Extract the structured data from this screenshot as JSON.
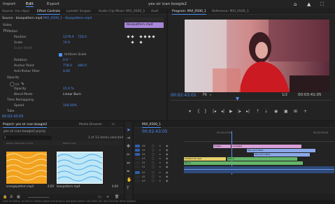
{
  "app": {
    "menus": [
      "Import",
      "Edit",
      "Export"
    ],
    "active_menu": "Edit",
    "title": "yes sir ican boogie2"
  },
  "source_panel": {
    "tabs": [
      "Source: (no clips)",
      "Effect Controls",
      "Lumetri Scopes",
      "Audio Clip Mixer: MVI_0500_1",
      "Audi"
    ],
    "active_tab": "Effect Controls",
    "clip_header": "Source · bluepattern.mp4",
    "seq_header": "MVI_0500_1 · bluepattern.mp4",
    "clip_tag": "bluepattern.mp4",
    "video_label": "Video",
    "motion_label": "Motion",
    "position_label": "Position",
    "position_x": "1279.9",
    "position_y": "720.0",
    "scale_label": "Scale",
    "scale_val": "74.9",
    "scale_width_label": "Scale Width",
    "uniform_scale_label": "Uniform Scale",
    "rotation_label": "Rotation",
    "rotation_val": "0.0 °",
    "anchor_label": "Anchor Point",
    "anchor_x": "778.0",
    "anchor_y": "480.0",
    "antiflicker_label": "Anti-flicker Filter",
    "antiflicker_val": "0.00",
    "opacity_section": "Opacity",
    "opacity_label": "Opacity",
    "opacity_val": "15.0 %",
    "blend_label": "Blend Mode",
    "blend_val": "Linear Burn",
    "time_remap_label": "Time Remapping",
    "speed_label": "Speed",
    "speed_val": "100.00%",
    "tube_label": "Tube",
    "timecode": "00:02:43:05"
  },
  "program_panel": {
    "tabs": [
      "Program: MVI_0500_1",
      "Reference: MVI_0500_1"
    ],
    "active_tab": "Program: MVI_0500_1",
    "timecode": "00:02:43:05",
    "fit": "Fit",
    "resolution": "1/2",
    "duration": "00:03:41:05"
  },
  "project_panel": {
    "tabs": [
      "Project: yes sir ican boogie2",
      "Media Browser",
      "Li"
    ],
    "active_tab": "Project: yes sir ican boogie2",
    "project_file": "yes sir ican boogie2.prproj",
    "selected_info": "1 of 13 items selected",
    "items": [
      {
        "name": "orangepattern.mp4",
        "duration": "4;00",
        "label": "Pattern (Steel Pat 1).mp4"
      },
      {
        "name": "bluepattern.mp4",
        "duration": "4;00",
        "label": "Pattern.mp4"
      }
    ]
  },
  "timeline_panel": {
    "tab": "MVI_0500_1",
    "timecode": "00:02:43:05",
    "ruler": [
      "00:02:43:05",
      "00:02:50:00"
    ],
    "video_tracks": [
      "V6",
      "V5",
      "V4",
      "V3",
      "V2",
      "V1"
    ],
    "audio_tracks": [
      "A1",
      "A2",
      "A3"
    ],
    "clips_v6": [],
    "clips": [
      {
        "label": "bluepa",
        "track": "V5"
      },
      {
        "label": "orangepa",
        "track": "V5b"
      },
      {
        "label": "MVI_0273.MOV",
        "track": "V4"
      },
      {
        "label": "MVI_0273.MOV",
        "track": "V3"
      },
      {
        "label": "Untitled 02.mp4",
        "track": "V2"
      },
      {
        "label": "MVI_0",
        "track": "V2b"
      },
      {
        "label": "MVI_0",
        "track": "V1"
      }
    ]
  },
  "status_bar": {
    "hint": "Click to select, or click in empty space and drag to marquee select. Use Shift, Alt, and Cmd for other options."
  },
  "colors": {
    "accent": "#4f8ff7",
    "clip_pink": "#d8a0c8",
    "clip_blue": "#8aa8e8",
    "clip_green": "#64b46a",
    "clip_yellow": "#e6cf6a",
    "playhead": "#4f8ff7"
  }
}
